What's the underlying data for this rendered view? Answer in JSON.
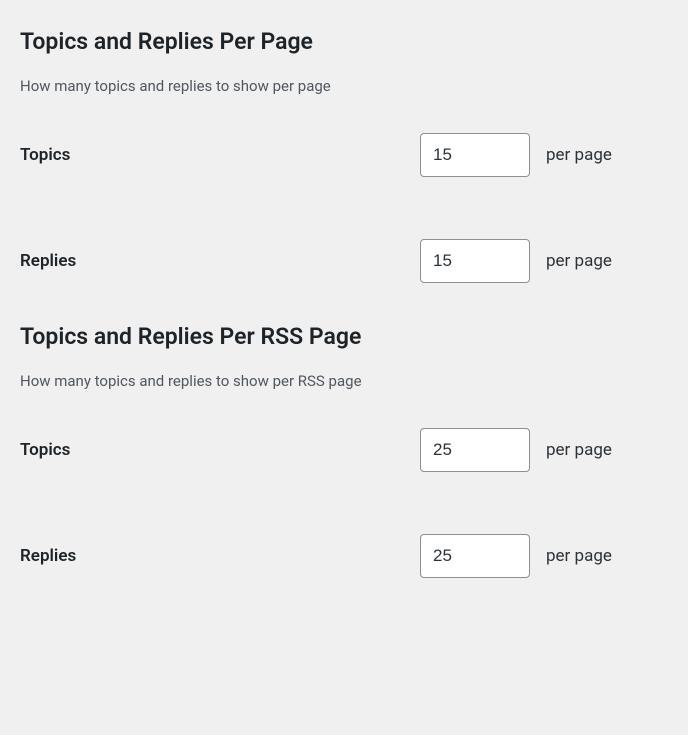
{
  "sections": {
    "per_page": {
      "title": "Topics and Replies Per Page",
      "description": "How many topics and replies to show per page",
      "fields": {
        "topics": {
          "label": "Topics",
          "value": "15",
          "suffix": "per page"
        },
        "replies": {
          "label": "Replies",
          "value": "15",
          "suffix": "per page"
        }
      }
    },
    "per_rss_page": {
      "title": "Topics and Replies Per RSS Page",
      "description": "How many topics and replies to show per RSS page",
      "fields": {
        "topics": {
          "label": "Topics",
          "value": "25",
          "suffix": "per page"
        },
        "replies": {
          "label": "Replies",
          "value": "25",
          "suffix": "per page"
        }
      }
    }
  }
}
